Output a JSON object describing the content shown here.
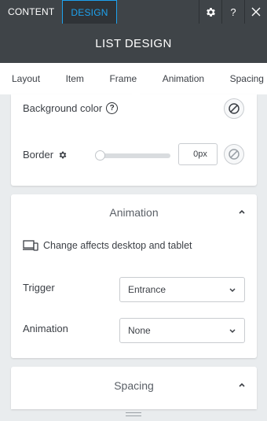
{
  "top_tabs": {
    "content": "CONTENT",
    "design": "DESIGN"
  },
  "top_icons": {
    "help": "?"
  },
  "title": "LIST DESIGN",
  "sub_tabs": [
    "Layout",
    "Item",
    "Frame",
    "Animation",
    "Spacing"
  ],
  "active_sub_tab": "Frame",
  "frame": {
    "background_label": "Background color",
    "help_glyph": "?",
    "border_label": "Border",
    "border_value": "0px",
    "border_slider_fraction": 0
  },
  "animation": {
    "title": "Animation",
    "note": "Change affects desktop and tablet",
    "trigger_label": "Trigger",
    "trigger_value": "Entrance",
    "animation_label": "Animation",
    "animation_value": "None"
  },
  "spacing": {
    "title": "Spacing"
  },
  "colors": {
    "accent": "#1ea2ee",
    "header_bg": "#3f4448",
    "panel_bg": "#e9ecee"
  },
  "icons": [
    "gear-icon",
    "help-icon",
    "close-icon",
    "no-color-icon",
    "devices-icon",
    "chevron-down-icon",
    "chevron-up-icon"
  ]
}
